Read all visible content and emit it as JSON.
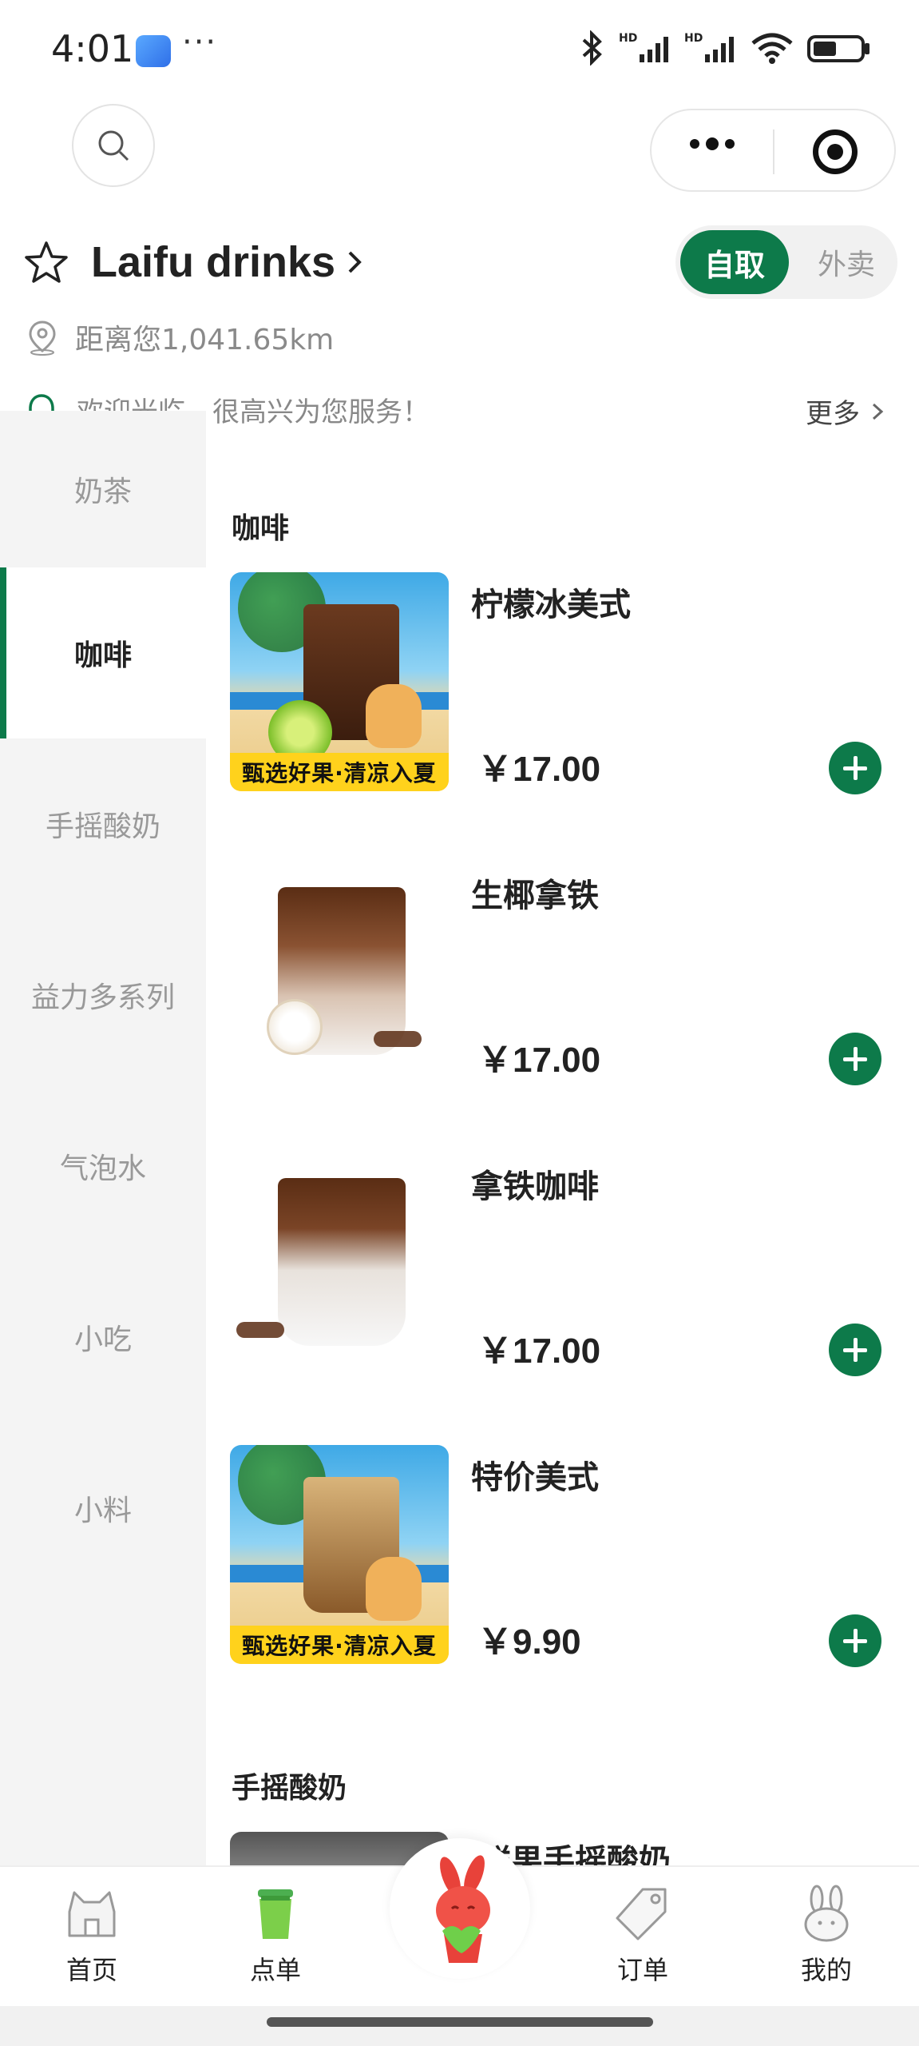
{
  "status_bar": {
    "time": "4:01",
    "dots": "···"
  },
  "header": {
    "store_name": "Laifu drinks",
    "mode_selected": "自取",
    "mode_other": "外卖",
    "distance": "距离您1,041.65km",
    "notice": "欢迎光临，很高兴为您服务！",
    "notice_more": "更多"
  },
  "sidebar": {
    "items": [
      {
        "label": "奶茶"
      },
      {
        "label": "咖啡"
      },
      {
        "label": "手摇酸奶"
      },
      {
        "label": "益力多系列"
      },
      {
        "label": "气泡水"
      },
      {
        "label": "小吃"
      },
      {
        "label": "小料"
      }
    ],
    "active_index": 1
  },
  "menu": {
    "section_coffee": "咖啡",
    "products": [
      {
        "name": "柠檬冰美式",
        "price": "￥17.00",
        "image": "beach",
        "banner": "甄选好果·清凉入夏"
      },
      {
        "name": "生椰拿铁",
        "price": "￥17.00",
        "image": "plain"
      },
      {
        "name": "拿铁咖啡",
        "price": "￥17.00",
        "image": "plain"
      },
      {
        "name": "特价美式",
        "price": "￥9.90",
        "image": "beach",
        "banner": "甄选好果·清凉入夏"
      }
    ],
    "section_yogurt": "手摇酸奶",
    "partial_product_name": "鲜果手摇酸奶"
  },
  "tabbar": {
    "items": [
      {
        "label": "首页",
        "icon": "home-icon"
      },
      {
        "label": "点单",
        "icon": "cup-icon"
      },
      {
        "label": "订单",
        "icon": "tag-icon"
      },
      {
        "label": "我的",
        "icon": "bunny-icon"
      }
    ]
  },
  "colors": {
    "accent": "#0d7a4a",
    "sidebar_bg": "#f4f4f4"
  }
}
